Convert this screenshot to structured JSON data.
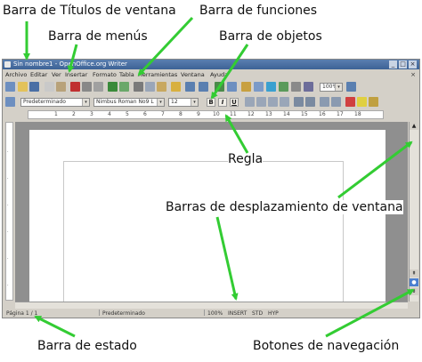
{
  "annotations": {
    "title_bar": "Barra de Títulos de ventana",
    "function_bar": "Barra de funciones",
    "menu_bar": "Barra de menús",
    "object_bar": "Barra de objetos",
    "ruler": "Regla",
    "scrollbars": "Barras de desplazamiento de ventana",
    "status_bar": "Barra de estado",
    "nav_buttons": "Botones de navegación"
  },
  "window": {
    "title": "Sin nombre1 - OpenOffice.org Writer",
    "controls": [
      "_",
      "□",
      "×"
    ]
  },
  "menu": {
    "items": [
      "Archivo",
      "Editar",
      "Ver",
      "Insertar",
      "Formato",
      "Tabla",
      "Herramientas",
      "Ventana",
      "Ayuda"
    ],
    "close": "×"
  },
  "function_toolbar": {
    "zoom_value": "100%"
  },
  "object_toolbar": {
    "style": "Predeterminado",
    "font": "Nimbus Roman No9 L",
    "size": "12",
    "bold": "B",
    "italic": "I",
    "underline": "U"
  },
  "ruler": {
    "ticks": [
      "1",
      "2",
      "3",
      "4",
      "5",
      "6",
      "7",
      "8",
      "9",
      "10",
      "11",
      "12",
      "13",
      "14",
      "15",
      "16",
      "17",
      "18"
    ]
  },
  "status": {
    "page": "Página 1 / 1",
    "style": "Predeterminado",
    "zoom": "100%",
    "insert": "INSERT",
    "std": "STD",
    "hyp": "HYP"
  },
  "colors": {
    "arrow": "#33cc33",
    "titlebar": "#4a6fa5"
  }
}
